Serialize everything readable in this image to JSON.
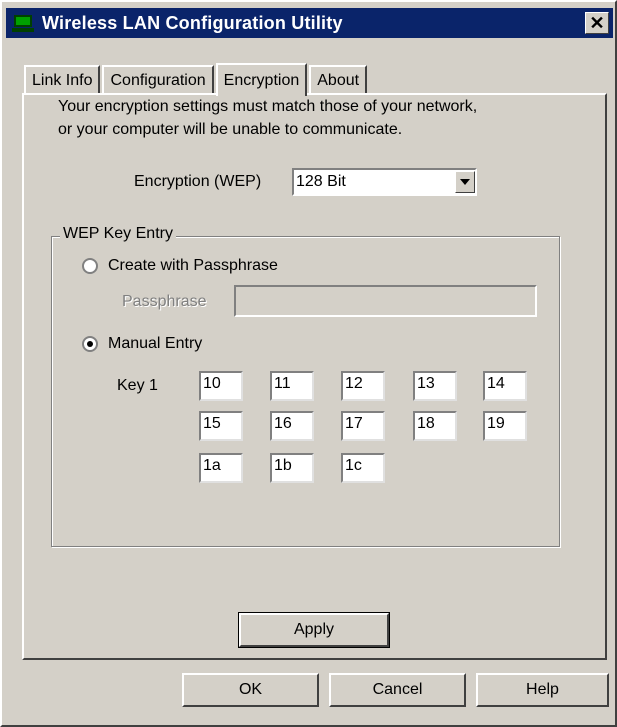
{
  "window": {
    "title": "Wireless LAN Configuration Utility",
    "close_label": "✕"
  },
  "tabs": [
    {
      "label": "Link Info",
      "active": false
    },
    {
      "label": "Configuration",
      "active": false
    },
    {
      "label": "Encryption",
      "active": true
    },
    {
      "label": "About",
      "active": false
    }
  ],
  "encryption": {
    "description_line1": "Your encryption settings must match those of your network,",
    "description_line2": "or your computer will be unable to communicate.",
    "wep_label": "Encryption (WEP)",
    "wep_value": "128 Bit"
  },
  "wep_key_entry": {
    "group_label": "WEP Key Entry",
    "passphrase_option": "Create with Passphrase",
    "passphrase_label": "Passphrase",
    "passphrase_value": "",
    "manual_option": "Manual Entry",
    "selected": "manual",
    "key_label": "Key 1",
    "key_values": [
      "10",
      "11",
      "12",
      "13",
      "14",
      "15",
      "16",
      "17",
      "18",
      "19",
      "1a",
      "1b",
      "1c"
    ]
  },
  "buttons": {
    "apply": "Apply",
    "ok": "OK",
    "cancel": "Cancel",
    "help": "Help"
  },
  "colors": {
    "titlebar": "#0a246a",
    "face": "#d4d0c8"
  }
}
